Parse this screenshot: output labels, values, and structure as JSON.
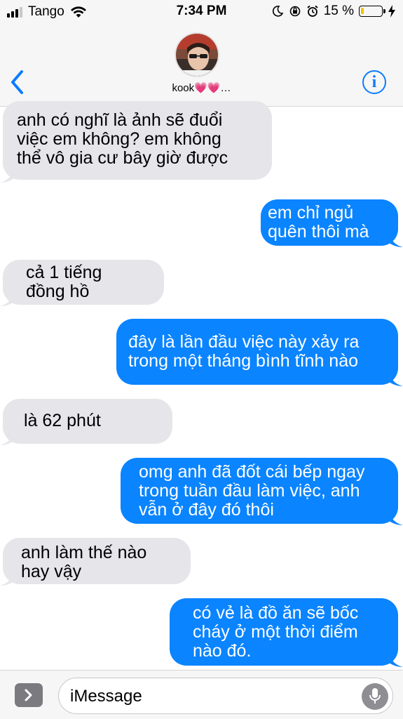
{
  "status_bar": {
    "carrier": "Tango",
    "time": "7:34 PM",
    "battery_percent": "15 %",
    "battery_level": 0.15,
    "battery_color": "#f0c40a",
    "icons": [
      "signal-icon",
      "wifi-icon",
      "moon-icon",
      "orientation-lock-icon",
      "alarm-icon",
      "battery-icon",
      "charging-bolt-icon"
    ]
  },
  "header": {
    "contact_name": "kook💗💗…",
    "back_icon": "chevron-left-icon",
    "info_icon": "info-icon",
    "info_glyph": "i",
    "accent_color": "#0a7cff"
  },
  "messages": [
    {
      "direction": "incoming",
      "text": "anh có nghĩ là ảnh sẽ đuổi\nviệc em không? em không\nthể vô gia cư bây giờ được"
    },
    {
      "direction": "outgoing",
      "text": "em chỉ ngủ\nquên thôi mà"
    },
    {
      "direction": "incoming",
      "text": "cả 1 tiếng\nđồng hồ"
    },
    {
      "direction": "outgoing",
      "text": "đây là lần đầu việc này xảy ra\ntrong một tháng bình tĩnh nào"
    },
    {
      "direction": "incoming",
      "text": "là 62 phút"
    },
    {
      "direction": "outgoing",
      "text": "omg anh đã đốt cái bếp ngay\ntrong tuần đầu làm việc, anh\nvẫn ở đây đó thôi"
    },
    {
      "direction": "incoming",
      "text": "anh làm thế nào\nhay vậy"
    },
    {
      "direction": "outgoing",
      "text": "có vẻ là đồ ăn sẽ bốc\ncháy ở một thời điểm\nnào đó."
    }
  ],
  "colors": {
    "incoming_bubble": "#e5e5ea",
    "outgoing_bubble": "#0a84ff"
  },
  "input_bar": {
    "placeholder": "iMessage",
    "apps_icon": "chevron-right-icon",
    "mic_icon": "microphone-icon"
  }
}
